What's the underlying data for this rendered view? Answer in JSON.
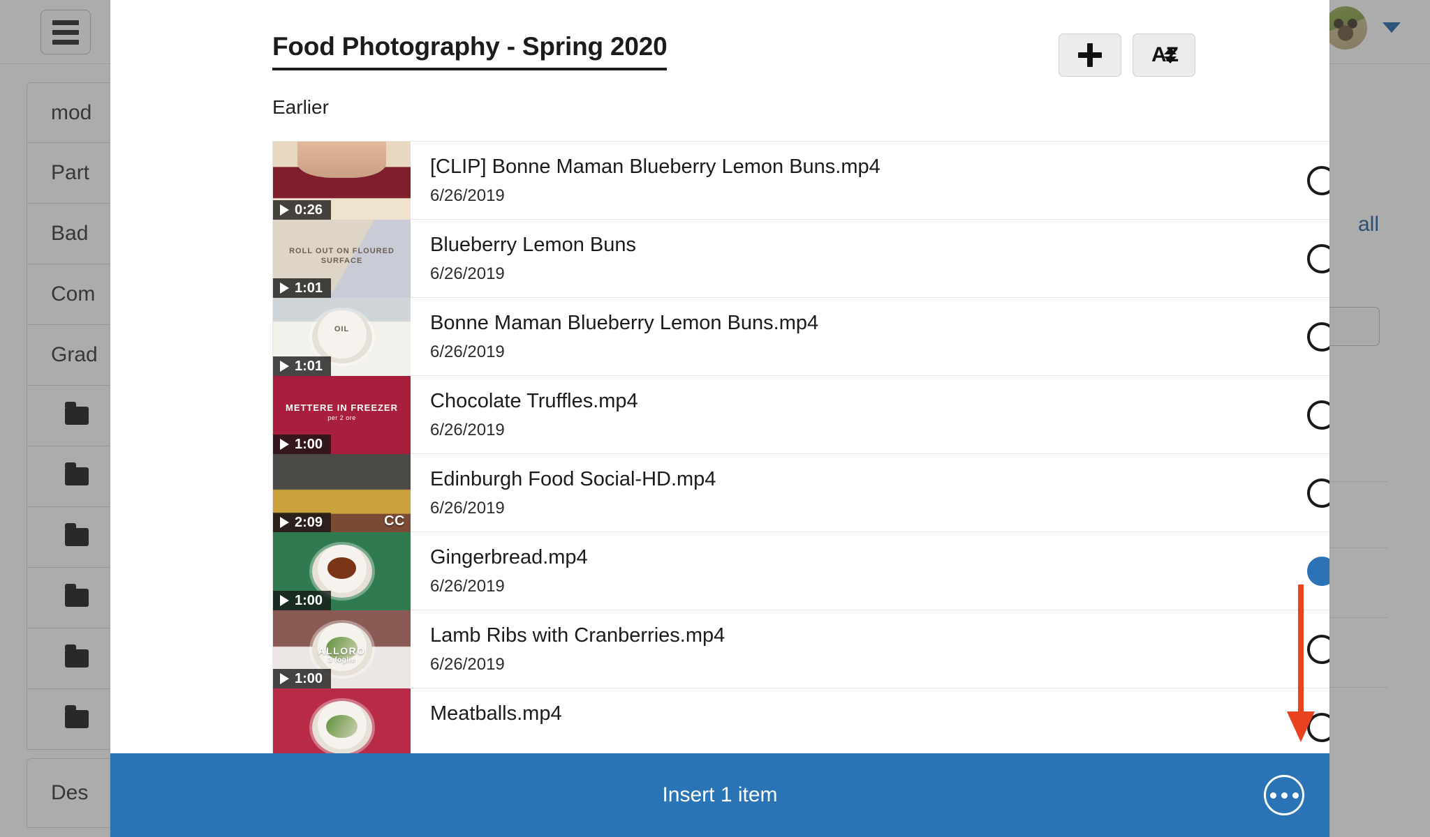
{
  "background": {
    "hamburger_icon": "hamburger-menu-icon",
    "avatar_icon": "user-avatar",
    "caret_icon": "chevron-down-icon",
    "sidebar_items": [
      {
        "label": "mod",
        "icon": null
      },
      {
        "label": "Part",
        "icon": null
      },
      {
        "label": "Bad",
        "icon": null
      },
      {
        "label": "Com",
        "icon": null
      },
      {
        "label": "Grad",
        "icon": null
      },
      {
        "label": "",
        "icon": "folder-icon"
      },
      {
        "label": "",
        "icon": "folder-icon"
      },
      {
        "label": "",
        "icon": "folder-icon"
      },
      {
        "label": "",
        "icon": "folder-icon"
      },
      {
        "label": "",
        "icon": "folder-icon"
      },
      {
        "label": "",
        "icon": "folder-icon"
      },
      {
        "label": "Des",
        "icon": null
      }
    ],
    "right_link": "all"
  },
  "modal": {
    "title": "Food Photography - Spring 2020",
    "section_label": "Earlier",
    "add_button": "+",
    "add_icon": "plus-icon",
    "sort_button": "AZ",
    "sort_icon": "sort-alpha-icon",
    "items": [
      {
        "name": "[CLIP] Bonne Maman Blueberry Lemon Buns.mp4",
        "date": "6/26/2019",
        "duration": "0:26",
        "cc": false,
        "selected": false,
        "thumb_class": "tA",
        "thumb_caption": "",
        "thumb_sub": ""
      },
      {
        "name": "Blueberry Lemon Buns",
        "date": "6/26/2019",
        "duration": "1:01",
        "cc": false,
        "selected": false,
        "thumb_class": "tB",
        "thumb_caption": "ROLL OUT ON FLOURED SURFACE",
        "thumb_sub": ""
      },
      {
        "name": "Bonne Maman Blueberry Lemon Buns.mp4",
        "date": "6/26/2019",
        "duration": "1:01",
        "cc": false,
        "selected": false,
        "thumb_class": "tC",
        "thumb_caption": "OIL",
        "thumb_sub": ""
      },
      {
        "name": "Chocolate Truffles.mp4",
        "date": "6/26/2019",
        "duration": "1:00",
        "cc": false,
        "selected": false,
        "thumb_class": "tD",
        "thumb_caption": "METTERE IN FREEZER",
        "thumb_sub": "per 2 ore"
      },
      {
        "name": "Edinburgh Food Social-HD.mp4",
        "date": "6/26/2019",
        "duration": "2:09",
        "cc": true,
        "cc_label": "CC",
        "selected": false,
        "thumb_class": "tE",
        "thumb_caption": "",
        "thumb_sub": ""
      },
      {
        "name": "Gingerbread.mp4",
        "date": "6/26/2019",
        "duration": "1:00",
        "cc": false,
        "selected": true,
        "thumb_class": "tF",
        "thumb_caption": "",
        "thumb_sub": ""
      },
      {
        "name": "Lamb Ribs with Cranberries.mp4",
        "date": "6/26/2019",
        "duration": "1:00",
        "cc": false,
        "selected": false,
        "thumb_class": "tG",
        "thumb_caption": "ALLORO",
        "thumb_sub": "3 foglie"
      },
      {
        "name": "Meatballs.mp4",
        "date": "",
        "duration": "",
        "cc": false,
        "selected": false,
        "thumb_class": "tH",
        "thumb_caption": "",
        "thumb_sub": ""
      }
    ],
    "footer": {
      "insert_label": "Insert 1 item",
      "more_icon": "more-options-icon"
    }
  },
  "annotation": {
    "arrow_icon": "down-arrow-annotation",
    "color": "#e8421f"
  },
  "colors": {
    "accent_blue": "#2a74b6",
    "selected_radio": "#2a72b5",
    "link_blue": "#18538f",
    "annotation_red": "#e8421f"
  }
}
